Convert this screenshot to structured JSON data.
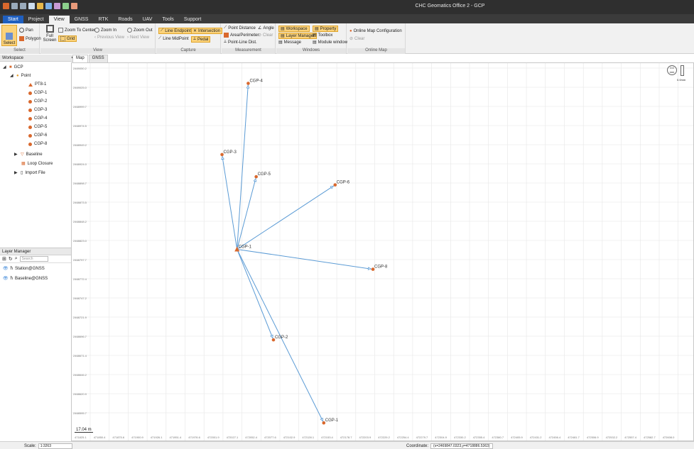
{
  "window": {
    "title": "CHC Geomatics Office 2 - GCP"
  },
  "menu_tabs": [
    "Start",
    "Project",
    "View",
    "GNSS",
    "RTK",
    "Roads",
    "UAV",
    "Tools",
    "Support"
  ],
  "ribbon": {
    "select": {
      "title": "Select",
      "select_label": "Select",
      "pan": "Pan",
      "polygon": "Polygon"
    },
    "view": {
      "title": "View",
      "full_screen": "Full Screen",
      "grid": "Grid",
      "zoom_to_center": "Zoom To Center",
      "zoom_in": "Zoom In",
      "zoom_out": "Zoom Out",
      "previous_view": "Previous View",
      "next_view": "Next View"
    },
    "capture": {
      "title": "Capture",
      "line_endpoint": "Line Endpoint",
      "intersection": "Intersection",
      "line_midpoint": "Line MidPoint",
      "pedal": "Pedal"
    },
    "measurement": {
      "title": "Measurement",
      "point_distance": "Point Distance",
      "angle": "Angle",
      "area_perimeter": "Area/Perimeter",
      "clear": "Clear",
      "point_line_dist": "Point-Line Dist."
    },
    "windows": {
      "title": "Windows",
      "workspace": "Workspace",
      "property": "Property",
      "layer_manager": "Layer Manager",
      "toolbox": "Toolbox",
      "message": "Message",
      "module_window": "Module window"
    },
    "online_map": {
      "title": "Online Map",
      "configuration": "Online Map Configuration",
      "clear": "Clear"
    }
  },
  "workspace": {
    "title": "Workspace",
    "pin": "▾ ✦ ✕",
    "root": "GCP",
    "point_group": "Point",
    "points": [
      "PT8-1",
      "CGP-1",
      "CGP-2",
      "CGP-3",
      "CGP-4",
      "CGP-5",
      "CGP-6",
      "CGP-8"
    ],
    "baseline": "Baseline",
    "loop_closure": "Loop Closure",
    "import_file": "Import File"
  },
  "layer_manager": {
    "title": "Layer Manager",
    "pin": "▾ ✦ ✕",
    "search_placeholder": "Search",
    "layers": [
      "Station@GNSS",
      "Baseline@GNSS"
    ]
  },
  "map": {
    "tabs": [
      "Map",
      "GNSS"
    ],
    "center_label": "CGP-1",
    "scale_widget": {
      "top": "0.0 mm",
      "bottom": "0.0mm"
    },
    "scale_bar": "17.04 m",
    "y_labels": [
      "2469050.2",
      "2469025.0",
      "2468999.7",
      "2468974.5",
      "2468949.2",
      "2468924.0",
      "2468898.7",
      "2468873.5",
      "2468848.2",
      "2468823.0",
      "2468797.7",
      "2468772.4",
      "2468747.2",
      "2468721.9",
      "2468696.7",
      "2468671.4",
      "2468646.2",
      "2468620.9",
      "2468595.7"
    ],
    "x_labels": [
      "471825.1",
      "471850.4",
      "471875.6",
      "471900.9",
      "471926.1",
      "471951.4",
      "471976.6",
      "472001.9",
      "472027.1",
      "472052.4",
      "472077.6",
      "472102.9",
      "472128.1",
      "472153.4",
      "472178.7",
      "472203.9",
      "472229.2",
      "472254.4",
      "472279.7",
      "472304.9",
      "472330.2",
      "472355.4",
      "472380.7",
      "472405.9",
      "472431.2",
      "472456.4",
      "472481.7",
      "472506.9",
      "472532.2",
      "472557.4",
      "472582.7",
      "472608.0"
    ],
    "points": [
      {
        "label": "CGP-4",
        "x": 472058.2,
        "y": 2469030.1,
        "center": false
      },
      {
        "label": "CGP-3",
        "x": 472023.3,
        "y": 2468936.2,
        "center": false
      },
      {
        "label": "CGP-5",
        "x": 472068.8,
        "y": 2468907.0,
        "center": false
      },
      {
        "label": "CGP-6",
        "x": 472173.9,
        "y": 2468896.2,
        "center": false
      },
      {
        "label": "CGP-1",
        "x": 472043.3,
        "y": 2468811.3,
        "center": true
      },
      {
        "label": "CGP-8",
        "x": 472224.3,
        "y": 2468785.0,
        "center": false
      },
      {
        "label": "CGP-2",
        "x": 472091.8,
        "y": 2468691.9,
        "center": false
      },
      {
        "label": "CGP-1",
        "x": 472158.8,
        "y": 2468582.4,
        "center": false
      }
    ]
  },
  "status": {
    "scale_label": "Scale:",
    "scale_value": "1:3263",
    "coord_label": "Coordinate:",
    "coord_value": "(x=2469847.0323,y=4718886.5363)"
  },
  "colors": {
    "line": "#5b9bd5",
    "point": "#d9682d",
    "accent": "#1f5fbf",
    "highlight": "#fbd27a"
  }
}
